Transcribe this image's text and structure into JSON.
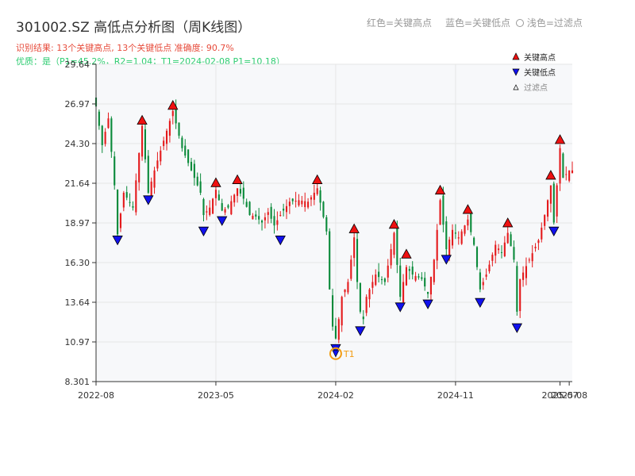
{
  "header": {
    "title": "301002.SZ 高低点分析图（周K线图）",
    "info_line1": "识别结果: 13个关键高点, 13个关键低点   准确度: 90.7%",
    "info_line2": "优质：是（P1=45.2%，R2=1.04；T1=2024-02-08 P1=10.18）",
    "legend_top": [
      "红色=关键高点",
      "蓝色=关键低点",
      "浅色=过滤点"
    ]
  },
  "colors": {
    "up": "#e41a1c",
    "down": "#0a8a3a",
    "high_marker": "#ee1111",
    "low_marker": "#1111ee",
    "t1_ring": "#f39c12",
    "info_red": "#e74c3c",
    "info_green": "#2ecc71",
    "plot_bg": "#f7f8fa",
    "grid": "#e6e6e6"
  },
  "chart_data": {
    "type": "candlestick",
    "ylim": [
      8.301,
      29.64
    ],
    "y_ticks": [
      "8.301",
      "10.97",
      "13.64",
      "16.30",
      "18.97",
      "21.64",
      "24.30",
      "26.97",
      "29.64"
    ],
    "x_ticks": [
      {
        "label": "2022-08",
        "x": 0
      },
      {
        "label": "2023-05",
        "x": 39
      },
      {
        "label": "2024-02",
        "x": 78
      },
      {
        "label": "2024-11",
        "x": 117
      },
      {
        "label": "2025-07",
        "x": 151
      },
      {
        "label": "2025-08",
        "x": 154
      }
    ],
    "x_range": [
      0,
      155
    ],
    "legend": [
      {
        "label": "关键高点",
        "marker": "high"
      },
      {
        "label": "关键低点",
        "marker": "low"
      },
      {
        "label": "过滤点",
        "marker": "filtered"
      }
    ],
    "anchors": [
      [
        0,
        26.8
      ],
      [
        2,
        24.2
      ],
      [
        4,
        26.0
      ],
      [
        6,
        21.5
      ],
      [
        7,
        18.2
      ],
      [
        9,
        21.0
      ],
      [
        12,
        20.0
      ],
      [
        15,
        25.5
      ],
      [
        17,
        21.0
      ],
      [
        19,
        22.5
      ],
      [
        22,
        24.5
      ],
      [
        25,
        26.5
      ],
      [
        28,
        24.0
      ],
      [
        31,
        22.5
      ],
      [
        34,
        21.0
      ],
      [
        35,
        19.5
      ],
      [
        37,
        20.0
      ],
      [
        39,
        21.2
      ],
      [
        41,
        19.8
      ],
      [
        43,
        20.0
      ],
      [
        46,
        21.3
      ],
      [
        48,
        20.6
      ],
      [
        50,
        19.5
      ],
      [
        52,
        19.4
      ],
      [
        54,
        19.0
      ],
      [
        56,
        19.7
      ],
      [
        58,
        18.8
      ],
      [
        60,
        19.5
      ],
      [
        63,
        20.4
      ],
      [
        66,
        20.5
      ],
      [
        69,
        20.4
      ],
      [
        72,
        21.3
      ],
      [
        75,
        18.4
      ],
      [
        76,
        14.5
      ],
      [
        77,
        12.0
      ],
      [
        78,
        11.2
      ],
      [
        79,
        12.5
      ],
      [
        80,
        14.0
      ],
      [
        82,
        15.0
      ],
      [
        84,
        18.0
      ],
      [
        85,
        15.0
      ],
      [
        86,
        13.0
      ],
      [
        87,
        12.5
      ],
      [
        88,
        14.0
      ],
      [
        91,
        15.5
      ],
      [
        94,
        15.0
      ],
      [
        97,
        18.3
      ],
      [
        99,
        14.0
      ],
      [
        101,
        16.0
      ],
      [
        103,
        15.5
      ],
      [
        106,
        15.2
      ],
      [
        108,
        14.2
      ],
      [
        110,
        16.5
      ],
      [
        112,
        20.5
      ],
      [
        114,
        17.2
      ],
      [
        116,
        18.5
      ],
      [
        118,
        18.0
      ],
      [
        121,
        19.2
      ],
      [
        123,
        17.5
      ],
      [
        125,
        14.5
      ],
      [
        127,
        15.5
      ],
      [
        130,
        17.5
      ],
      [
        132,
        17.0
      ],
      [
        134,
        18.3
      ],
      [
        136,
        16.5
      ],
      [
        137,
        13.0
      ],
      [
        138,
        15.2
      ],
      [
        141,
        16.5
      ],
      [
        144,
        17.8
      ],
      [
        146,
        19.5
      ],
      [
        148,
        21.5
      ],
      [
        149,
        19.0
      ],
      [
        151,
        24.0
      ],
      [
        152,
        22.0
      ],
      [
        154,
        22.5
      ]
    ],
    "key_highs": [
      {
        "x": 15,
        "price": 25.5
      },
      {
        "x": 25,
        "price": 26.5
      },
      {
        "x": 39,
        "price": 21.3
      },
      {
        "x": 46,
        "price": 21.5
      },
      {
        "x": 72,
        "price": 21.5
      },
      {
        "x": 84,
        "price": 18.2
      },
      {
        "x": 97,
        "price": 18.5
      },
      {
        "x": 101,
        "price": 16.5
      },
      {
        "x": 112,
        "price": 20.8
      },
      {
        "x": 121,
        "price": 19.5
      },
      {
        "x": 134,
        "price": 18.6
      },
      {
        "x": 148,
        "price": 21.8
      },
      {
        "x": 151,
        "price": 24.2
      }
    ],
    "key_lows": [
      {
        "x": 7,
        "price": 18.2
      },
      {
        "x": 17,
        "price": 20.9
      },
      {
        "x": 35,
        "price": 18.8
      },
      {
        "x": 41,
        "price": 19.5
      },
      {
        "x": 60,
        "price": 18.2
      },
      {
        "x": 78,
        "price": 10.9
      },
      {
        "x": 86,
        "price": 12.1
      },
      {
        "x": 99,
        "price": 13.7
      },
      {
        "x": 108,
        "price": 13.9
      },
      {
        "x": 114,
        "price": 16.9
      },
      {
        "x": 125,
        "price": 14.0
      },
      {
        "x": 137,
        "price": 12.3
      },
      {
        "x": 149,
        "price": 18.8
      }
    ],
    "t1": {
      "label": "T1",
      "x": 78,
      "price": 10.18
    }
  }
}
